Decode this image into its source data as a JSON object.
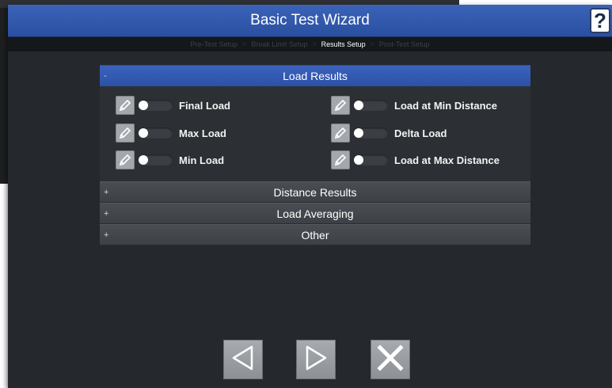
{
  "window": {
    "title": "Basic Test Wizard",
    "help_label": "?"
  },
  "breadcrumb": [
    {
      "label": "Pre-Test Setup",
      "active": false
    },
    {
      "label": "Break Limit Setup",
      "active": false
    },
    {
      "label": "Results Setup",
      "active": true
    },
    {
      "label": "Post-Test Setup",
      "active": false
    }
  ],
  "breadcrumb_separator": ">",
  "sections": [
    {
      "title": "Load Results",
      "toggle": "-",
      "expanded": true,
      "items": [
        {
          "label": "Final Load",
          "enabled": false
        },
        {
          "label": "Load at Min Distance",
          "enabled": false
        },
        {
          "label": "Max Load",
          "enabled": false
        },
        {
          "label": "Delta Load",
          "enabled": false
        },
        {
          "label": "Min Load",
          "enabled": false
        },
        {
          "label": "Load at Max Distance",
          "enabled": false
        }
      ]
    },
    {
      "title": "Distance Results",
      "toggle": "+",
      "expanded": false
    },
    {
      "title": "Load Averaging",
      "toggle": "+",
      "expanded": false
    },
    {
      "title": "Other",
      "toggle": "+",
      "expanded": false
    }
  ],
  "footer": {
    "back": "back-arrow-icon",
    "next": "next-arrow-icon",
    "cancel": "close-icon"
  },
  "colors": {
    "title_bar": "#2f58ab",
    "section_open": "#2f56ad",
    "background": "#25292d"
  }
}
